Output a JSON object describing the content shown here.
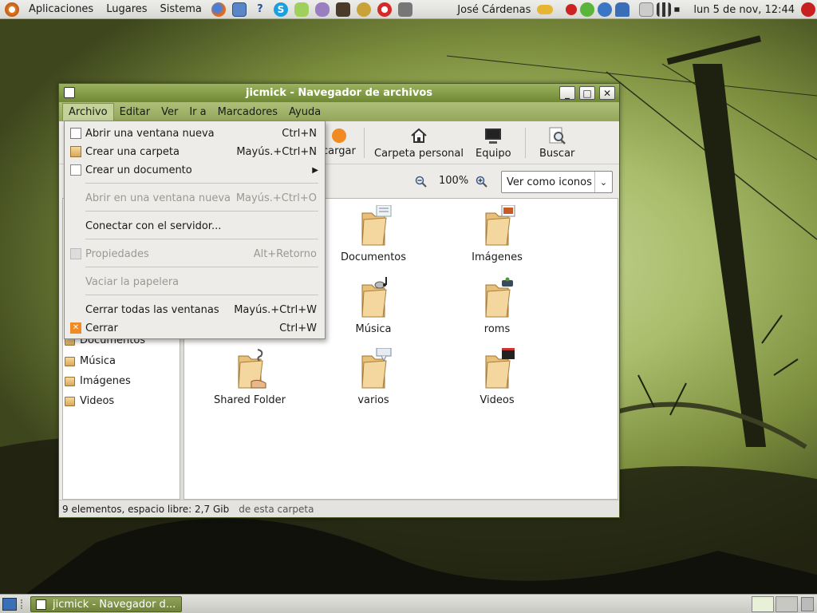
{
  "top_panel": {
    "menus": [
      "Aplicaciones",
      "Lugares",
      "Sistema"
    ],
    "user_name": "José Cárdenas",
    "clock": "lun  5 de nov, 12:44"
  },
  "window": {
    "title": "jicmick - Navegador de archivos",
    "menubar": [
      "Archivo",
      "Editar",
      "Ver",
      "Ir a",
      "Marcadores",
      "Ayuda"
    ],
    "toolbar": {
      "partial_button": "cargar",
      "home": "Carpeta personal",
      "computer": "Equipo",
      "search": "Buscar"
    },
    "zoom": "100%",
    "view_mode": "Ver como iconos",
    "sidebar_items": [
      "Documentos",
      "Música",
      "Imágenes",
      "Videos"
    ],
    "files": [
      {
        "name": "Documentos"
      },
      {
        "name": "Imágenes"
      },
      {
        "name": "Música"
      },
      {
        "name": "roms"
      },
      {
        "name": "Shared Folder"
      },
      {
        "name": "varios"
      },
      {
        "name": "Videos"
      }
    ],
    "status": "9 elementos, espacio libre: 2,7 Gib",
    "status_overlap": "de esta carpeta"
  },
  "archivo_menu": {
    "items": [
      {
        "label": "Abrir una ventana nueva",
        "accel": "Ctrl+N",
        "enabled": true
      },
      {
        "label": "Crear una carpeta",
        "accel": "Mayús.+Ctrl+N",
        "enabled": true
      },
      {
        "label": "Crear un documento",
        "accel": "",
        "enabled": true
      },
      {
        "label": "Abrir en una ventana nueva",
        "accel": "Mayús.+Ctrl+O",
        "enabled": false
      },
      {
        "label": "Conectar con el servidor...",
        "accel": "",
        "enabled": true
      },
      {
        "label": "Propiedades",
        "accel": "Alt+Retorno",
        "enabled": false
      },
      {
        "label": "Vaciar la papelera",
        "accel": "",
        "enabled": false
      },
      {
        "label": "Cerrar todas las ventanas",
        "accel": "Mayús.+Ctrl+W",
        "enabled": true
      },
      {
        "label": "Cerrar",
        "accel": "Ctrl+W",
        "enabled": true
      }
    ]
  },
  "taskbar": {
    "task_title": "jicmick - Navegador d..."
  },
  "colors": {
    "titlebar": "#7f9a40",
    "menubar": "#a3b56a",
    "panel": "#e2e2de"
  }
}
